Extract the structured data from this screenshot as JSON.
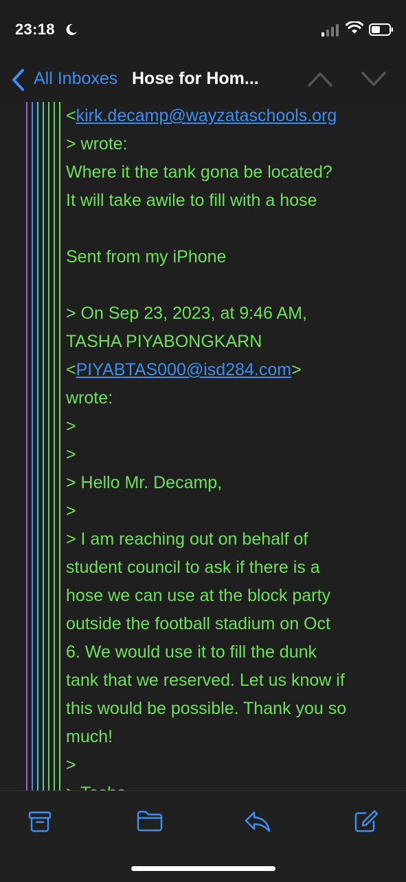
{
  "status_bar": {
    "time": "23:18"
  },
  "nav": {
    "back_label": "All Inboxes",
    "title": "Hose for Hom..."
  },
  "email": {
    "link_kirk": "kirk.decamp@wayzataschools.org",
    "link_tasha": "PIYABTAS000@isd284.com",
    "lines": [
      "> wrote:",
      "Where it the tank gona be located?",
      "It will take awile to fill with a hose",
      "",
      "Sent from my iPhone",
      "",
      "> On Sep 23, 2023, at 9:46 AM,",
      "TASHA PIYABONGKARN",
      "",
      "wrote:",
      ">",
      ">",
      "> Hello Mr. Decamp,",
      ">",
      "> I am reaching out on behalf of",
      "student council to ask if there is a",
      "hose we can use at the block party",
      "outside the football stadium on Oct",
      "6. We would use it to fill the dunk",
      "tank that we reserved. Let us know if",
      "this would be possible. Thank you so",
      "much!",
      ">",
      "> Tasha"
    ]
  },
  "toolbar": {
    "archive_icon": "archive-icon",
    "folder_icon": "folder-icon",
    "reply_icon": "reply-icon",
    "compose_icon": "compose-icon"
  },
  "colors": {
    "accent": "#3d8ef0",
    "quote_text": "#6ee05a",
    "background": "#1f1f1f"
  }
}
